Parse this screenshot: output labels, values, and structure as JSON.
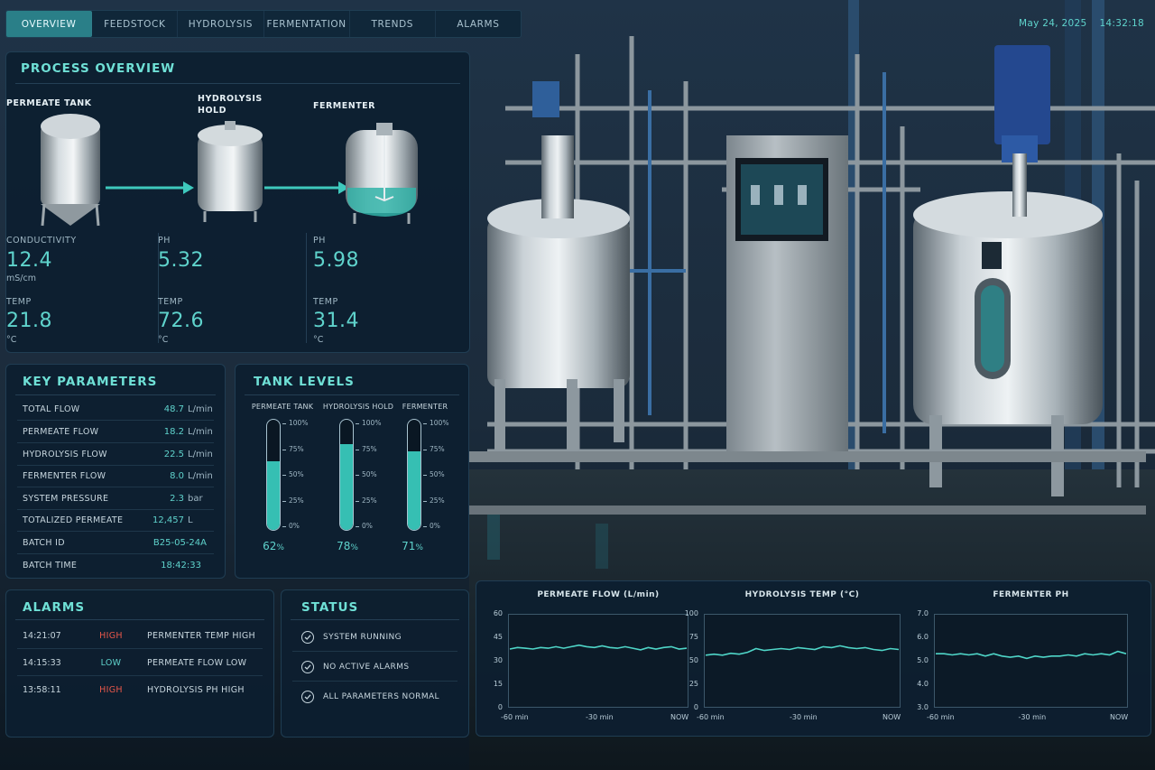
{
  "nav": {
    "tabs": [
      "OVERVIEW",
      "FEEDSTOCK",
      "HYDROLYSIS",
      "FERMENTATION",
      "TRENDS",
      "ALARMS"
    ],
    "active": 0
  },
  "header": {
    "date": "May 24, 2025",
    "time": "14:32:18"
  },
  "process_overview": {
    "title": "PROCESS OVERVIEW",
    "units": [
      {
        "name": "PERMEATE TANK",
        "m1_label": "CONDUCTIVITY",
        "m1_value": "12.4",
        "m1_unit": "mS/cm",
        "m2_label": "TEMP",
        "m2_value": "21.8",
        "m2_unit": "°C"
      },
      {
        "name": "HYDROLYSIS HOLD",
        "m1_label": "PH",
        "m1_value": "5.32",
        "m1_unit": "",
        "m2_label": "TEMP",
        "m2_value": "72.6",
        "m2_unit": "°C"
      },
      {
        "name": "FERMENTER",
        "m1_label": "PH",
        "m1_value": "5.98",
        "m1_unit": "",
        "m2_label": "TEMP",
        "m2_value": "31.4",
        "m2_unit": "°C"
      }
    ]
  },
  "key_parameters": {
    "title": "KEY PARAMETERS",
    "rows": [
      {
        "label": "TOTAL FLOW",
        "value": "48.7",
        "unit": "L/min"
      },
      {
        "label": "PERMEATE FLOW",
        "value": "18.2",
        "unit": "L/min"
      },
      {
        "label": "HYDROLYSIS FLOW",
        "value": "22.5",
        "unit": "L/min"
      },
      {
        "label": "FERMENTER FLOW",
        "value": "8.0",
        "unit": "L/min"
      },
      {
        "label": "SYSTEM PRESSURE",
        "value": "2.3",
        "unit": "bar"
      },
      {
        "label": "TOTALIZED PERMEATE",
        "value": "12,457",
        "unit": "L"
      },
      {
        "label": "BATCH ID",
        "value": "B25-05-24A",
        "unit": ""
      },
      {
        "label": "BATCH TIME",
        "value": "18:42:33",
        "unit": ""
      }
    ]
  },
  "tank_levels": {
    "title": "TANK LEVELS",
    "ticks": [
      "100%",
      "75%",
      "50%",
      "25%",
      "0%"
    ],
    "tanks": [
      {
        "name": "PERMEATE TANK",
        "level": 62,
        "level_text": "62",
        "pct": "%"
      },
      {
        "name": "HYDROLYSIS HOLD",
        "level": 78,
        "level_text": "78",
        "pct": "%"
      },
      {
        "name": "FERMENTER",
        "level": 71,
        "level_text": "71",
        "pct": "%"
      }
    ]
  },
  "alarms": {
    "title": "ALARMS",
    "rows": [
      {
        "time": "14:21:07",
        "severity": "HIGH",
        "message": "PERMENTER TEMP HIGH"
      },
      {
        "time": "14:15:33",
        "severity": "LOW",
        "message": "PERMEATE FLOW LOW"
      },
      {
        "time": "13:58:11",
        "severity": "HIGH",
        "message": "HYDROLYSIS PH HIGH"
      }
    ],
    "colors": {
      "HIGH": "#e8574a",
      "LOW": "#5fd3cc"
    }
  },
  "status": {
    "title": "STATUS",
    "items": [
      "SYSTEM RUNNING",
      "NO ACTIVE ALARMS",
      "ALL PARAMETERS NORMAL"
    ]
  },
  "colors": {
    "accent": "#5fd3cc",
    "accent_dark": "#2a7f88",
    "alarm_high": "#e8574a"
  },
  "chart_data": [
    {
      "type": "line",
      "title": "PERMEATE FLOW (L/min)",
      "x": [
        "-60 min",
        "-30 min",
        "NOW"
      ],
      "yticks": [
        60,
        45,
        30,
        15,
        0
      ],
      "ylim": [
        0,
        60
      ],
      "series": [
        {
          "values": [
            37.5,
            38.5,
            38,
            37.5,
            38.5,
            38,
            39,
            38,
            39,
            40,
            39,
            38.5,
            39.5,
            38.5,
            38,
            39,
            38,
            37,
            38.5,
            37.5,
            38.5,
            39,
            37.5,
            38
          ]
        }
      ]
    },
    {
      "type": "line",
      "title": "HYDROLYSIS TEMP (°C)",
      "x": [
        "-60 min",
        "-30 min",
        "NOW"
      ],
      "yticks": [
        100,
        75,
        50,
        25,
        0
      ],
      "ylim": [
        0,
        100
      ],
      "series": [
        {
          "values": [
            56,
            57,
            56,
            58,
            57,
            59,
            63,
            61,
            62,
            63,
            62,
            64,
            63,
            62,
            65,
            64,
            66,
            64,
            63,
            64,
            62,
            61,
            63,
            62
          ]
        }
      ]
    },
    {
      "type": "line",
      "title": "FERMENTER PH",
      "x": [
        "-60 min",
        "-30 min",
        "NOW"
      ],
      "yticks": [
        "7.0",
        "6.0",
        "5.0",
        "4.0",
        "3.0"
      ],
      "ylim": [
        3,
        7
      ],
      "series": [
        {
          "values": [
            5.3,
            5.3,
            5.25,
            5.3,
            5.25,
            5.3,
            5.2,
            5.3,
            5.2,
            5.15,
            5.2,
            5.1,
            5.2,
            5.15,
            5.2,
            5.2,
            5.25,
            5.2,
            5.3,
            5.25,
            5.3,
            5.25,
            5.4,
            5.3
          ]
        }
      ]
    }
  ]
}
